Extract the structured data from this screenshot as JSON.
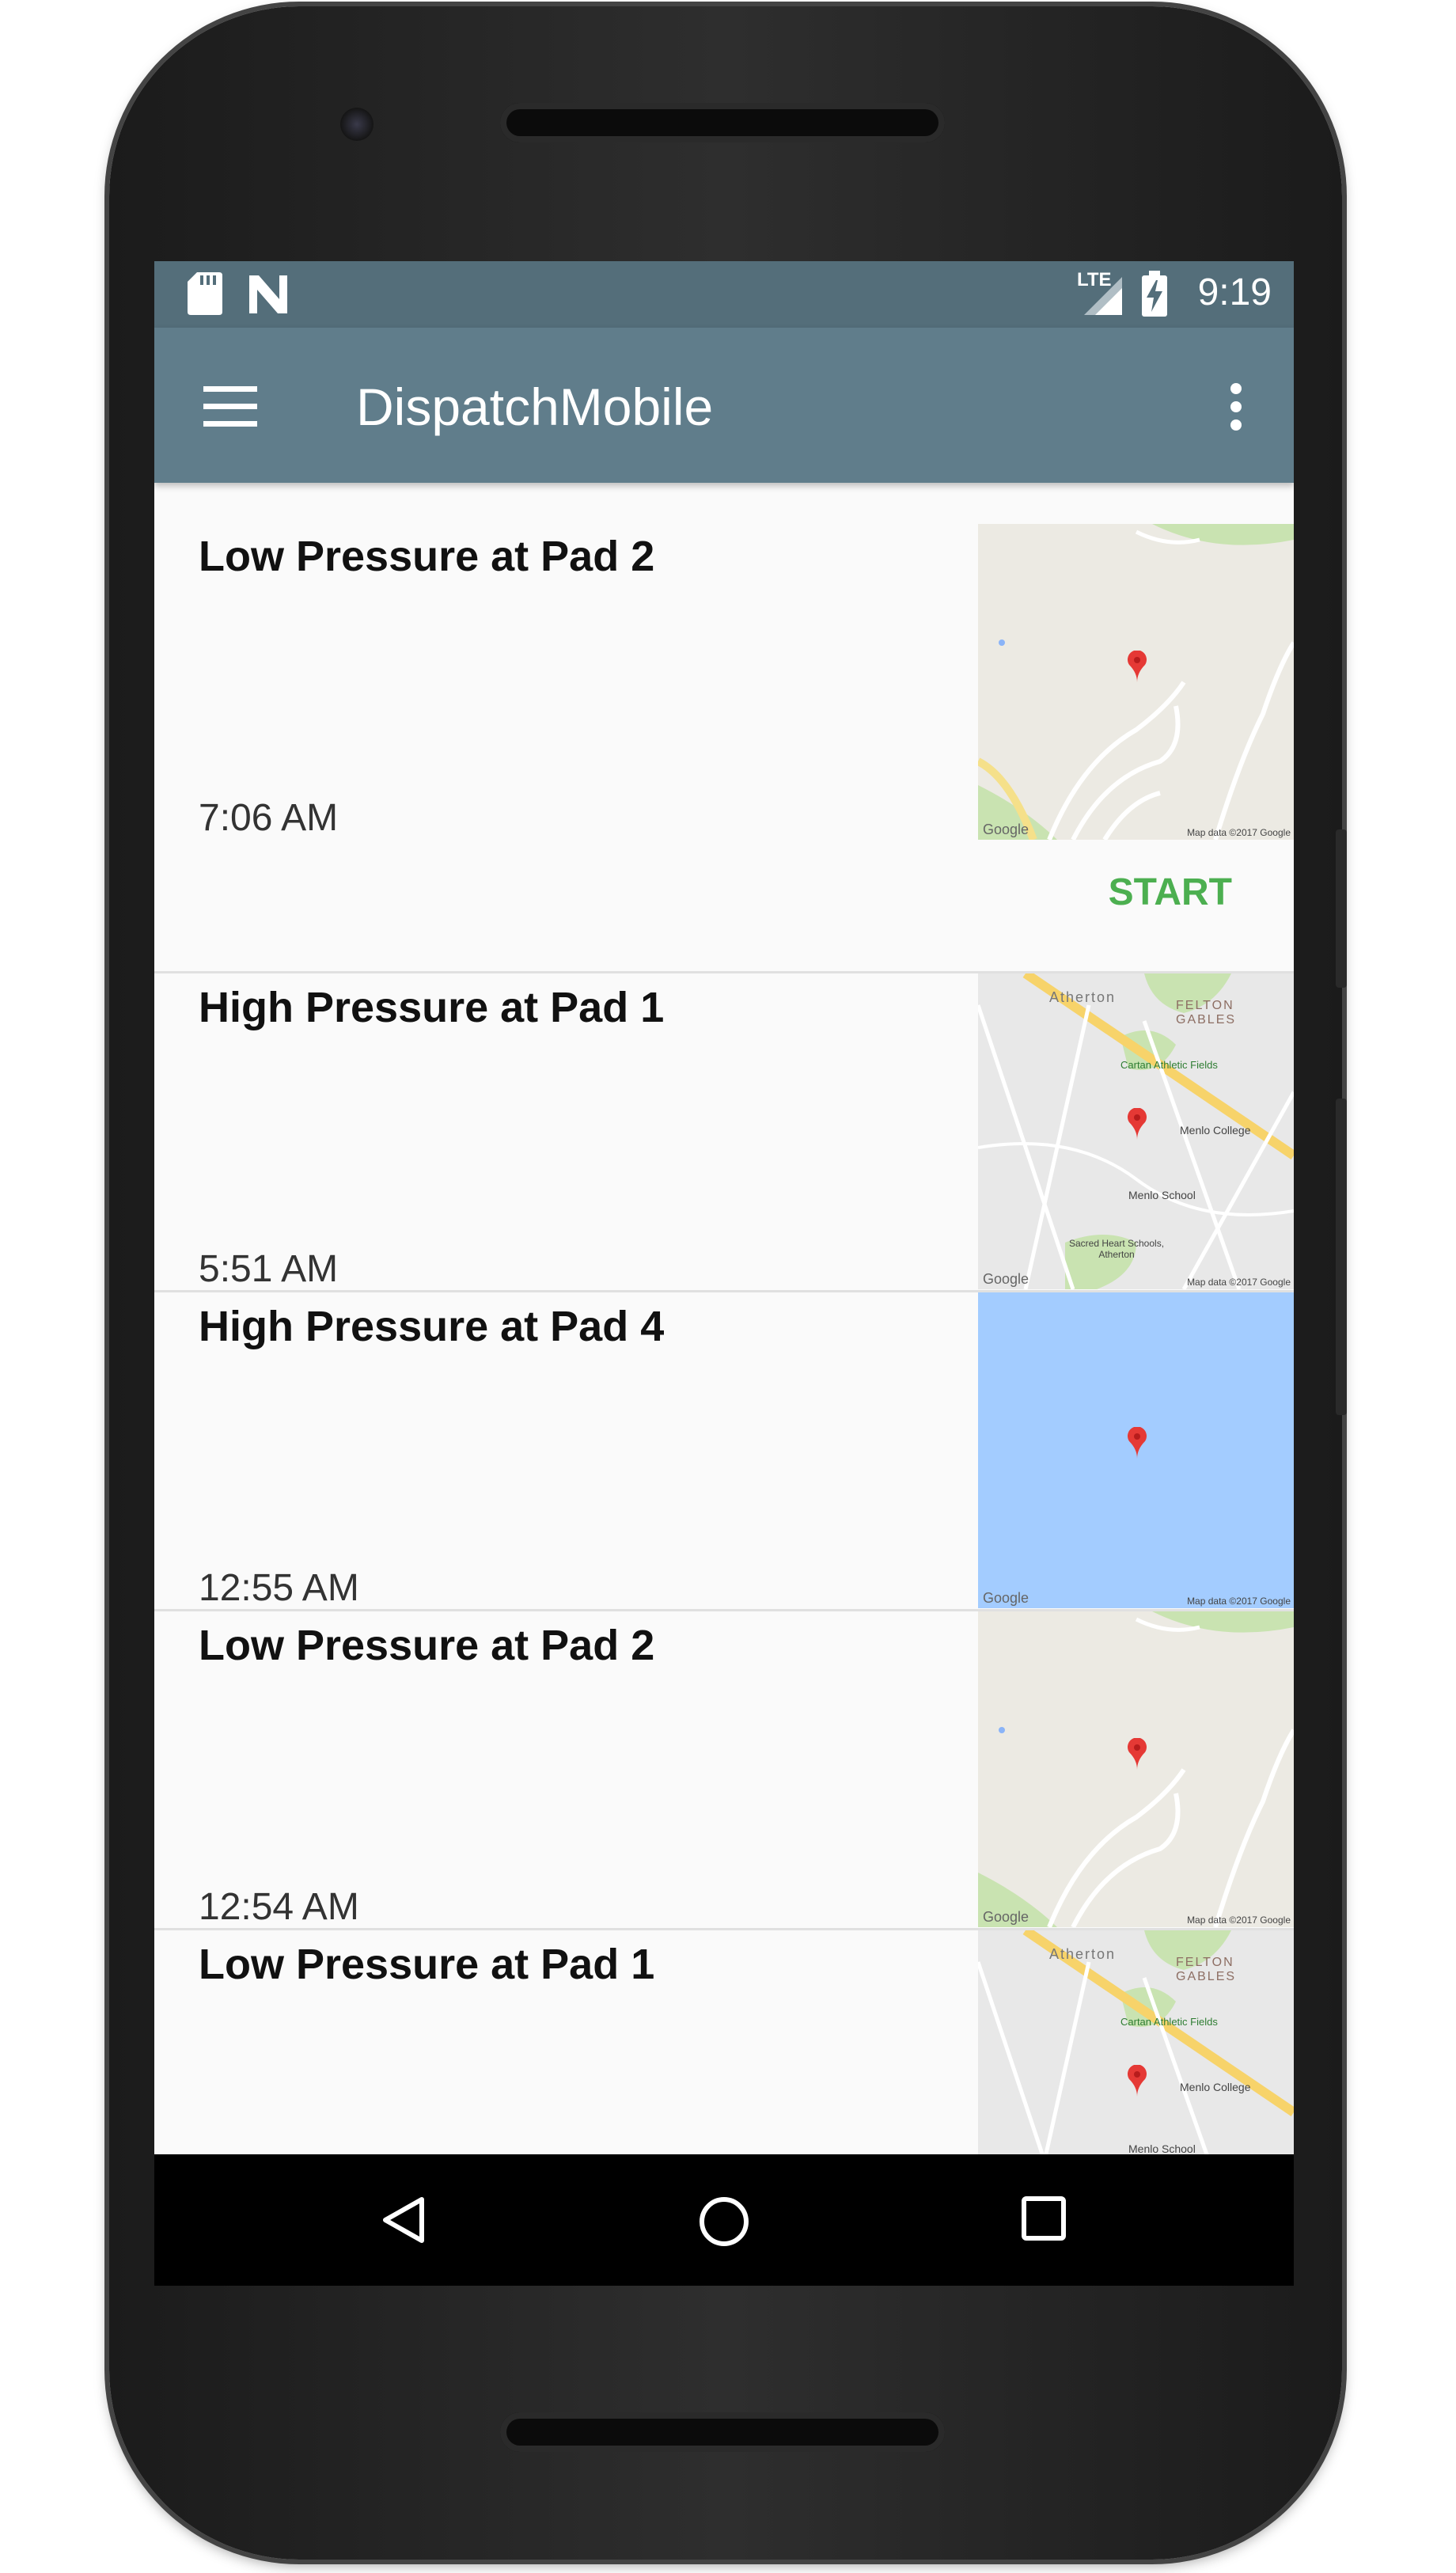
{
  "status_bar": {
    "time": "9:19",
    "network_label": "LTE",
    "icons": [
      "sd-card-icon",
      "n-notification-icon",
      "lte-signal-icon",
      "battery-charging-icon"
    ]
  },
  "app_bar": {
    "title": "DispatchMobile",
    "menu_icon": "hamburger-menu-icon",
    "overflow_icon": "overflow-menu-icon"
  },
  "items": [
    {
      "title": "Low Pressure at Pad 2",
      "time": "7:06 AM",
      "action": "START",
      "map": "terrain"
    },
    {
      "title": "High Pressure at Pad 1",
      "time": "5:51 AM",
      "map": "streets"
    },
    {
      "title": "High Pressure at Pad 4",
      "time": "12:55 AM",
      "map": "water"
    },
    {
      "title": "Low Pressure at Pad 2",
      "time": "12:54 AM",
      "map": "terrain"
    },
    {
      "title": "Low Pressure at Pad 1",
      "map": "streets"
    }
  ],
  "maps": {
    "google_label": "Google",
    "map_data_label": "Map data ©2017 Google",
    "street_labels": {
      "atherton": "Atherton",
      "felton": "FELTON GABLES",
      "cartan": "Cartan Athletic Fields",
      "menlo_college": "Menlo College",
      "menlo_school": "Menlo School",
      "sacred_heart": "Sacred Heart Schools, Atherton"
    }
  },
  "nav_bar": {
    "icons": [
      "back-icon",
      "home-icon",
      "recents-icon"
    ]
  },
  "colors": {
    "status_bar": "#546e7a",
    "app_bar": "#607d8b",
    "accent": "#4caf50",
    "water": "#a3ccff"
  }
}
